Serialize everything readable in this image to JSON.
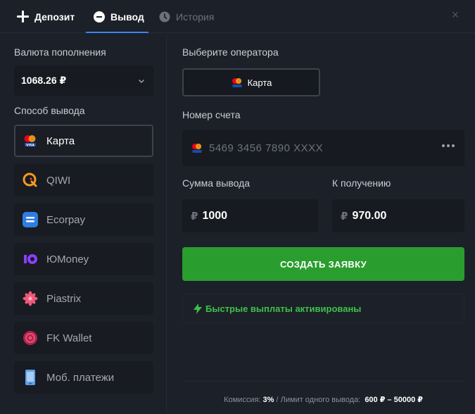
{
  "tabs": [
    {
      "label": "Депозит",
      "icon": "plus-icon",
      "active": false
    },
    {
      "label": "Вывод",
      "icon": "minus-circle-icon",
      "active": true
    },
    {
      "label": "История",
      "icon": "clock-icon",
      "active": false
    }
  ],
  "left": {
    "currency_label": "Валюта пополнения",
    "currency_value": "1068.26 ₽",
    "method_label": "Способ вывода",
    "methods": [
      {
        "label": "Карта",
        "icon": "card-icon",
        "active": true
      },
      {
        "label": "QIWI",
        "icon": "qiwi-icon",
        "active": false
      },
      {
        "label": "Ecorpay",
        "icon": "ecorpay-icon",
        "active": false
      },
      {
        "label": "ЮMoney",
        "icon": "yumoney-icon",
        "active": false
      },
      {
        "label": "Piastrix",
        "icon": "piastrix-icon",
        "active": false
      },
      {
        "label": "FK Wallet",
        "icon": "fkwallet-icon",
        "active": false
      },
      {
        "label": "Моб. платежи",
        "icon": "phone-icon",
        "active": false
      }
    ]
  },
  "right": {
    "operator_label": "Выберите оператора",
    "operator_value": "Карта",
    "account_label": "Номер счета",
    "account_placeholder": "5469 3456 7890 XXXX",
    "amount_label": "Сумма вывода",
    "amount_currency": "₽",
    "amount_value": "1000",
    "receive_label": "К получению",
    "receive_currency": "₽",
    "receive_value": "970.00",
    "submit_label": "СОЗДАТЬ ЗАЯВКУ",
    "fast_text": "Быстрые выплаты активированы"
  },
  "footer": {
    "commission_label": "Комиссия:",
    "commission_value": "3%",
    "separator": "/",
    "limit_label": "Лимит одного вывода:",
    "limit_value": "600 ₽ – 50000 ₽"
  },
  "colors": {
    "background": "#1c2028",
    "accent": "#3b82f6",
    "submit": "#2a9d2f",
    "success": "#3ec14a"
  }
}
